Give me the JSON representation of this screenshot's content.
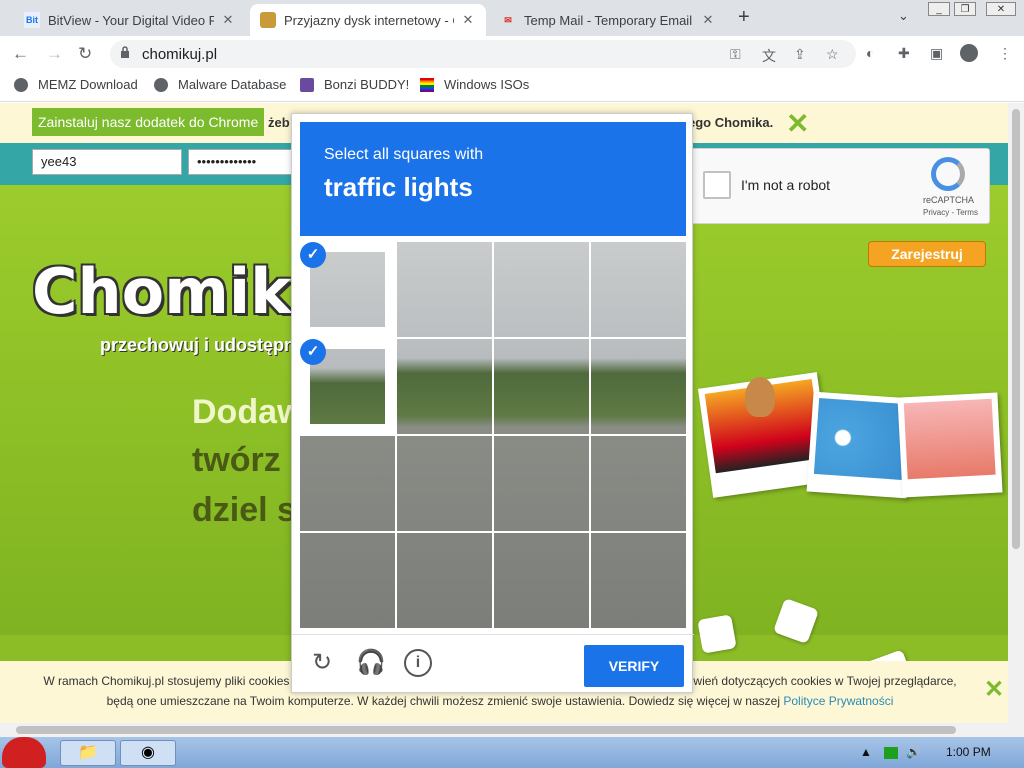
{
  "browser": {
    "tabs": [
      {
        "title": "BitView - Your Digital Video Re",
        "favicon": "Bit",
        "active": false
      },
      {
        "title": "Przyjazny dysk internetowy - C",
        "favicon": "chomik",
        "active": true
      },
      {
        "title": "Temp Mail - Temporary Email",
        "favicon": "M",
        "active": false
      }
    ],
    "url": "chomikuj.pl",
    "bookmarks": [
      "MEMZ Download",
      "Malware Database",
      "Bonzi BUDDY!",
      "Windows ISOs"
    ]
  },
  "site": {
    "promo_button": "Zainstaluj nasz dodatek do Chrome",
    "promo_text_start": "żeb",
    "promo_text_end": "ego Chomika.",
    "username": "yee43",
    "password": "•••••••••••••",
    "logo": "Chomikuj.",
    "tagline": "przechowuj i udostępni",
    "headline_1": "Dodaw",
    "headline_2": "twórz",
    "headline_3": "dziel s",
    "register_button": "Zarejestruj",
    "cookie_line_1": "W ramach Chomikuj.pl stosujemy pliki cookies",
    "cookie_line_1_end": "wień dotyczących cookies w Twojej przeglądarce,",
    "cookie_line_2": "będą one umieszczane na Twoim komputerze. W każdej chwili możesz zmienić swoje ustawienia. Dowiedz się więcej w naszej",
    "cookie_link": "Polityce Prywatności"
  },
  "recaptcha": {
    "checkbox_label": "I'm not a robot",
    "brand": "reCAPTCHA",
    "links": "Privacy - Terms",
    "challenge_instruction": "Select all squares with",
    "challenge_target": "traffic lights",
    "verify_button": "VERIFY",
    "selected_cells": [
      0,
      4
    ],
    "grid_size": 4
  },
  "taskbar": {
    "clock": "1:00 PM"
  },
  "colors": {
    "accent_blue": "#1a73e8",
    "site_green": "#8cbc26",
    "promo_green": "#7cba2e",
    "register_orange": "#f4a422"
  }
}
